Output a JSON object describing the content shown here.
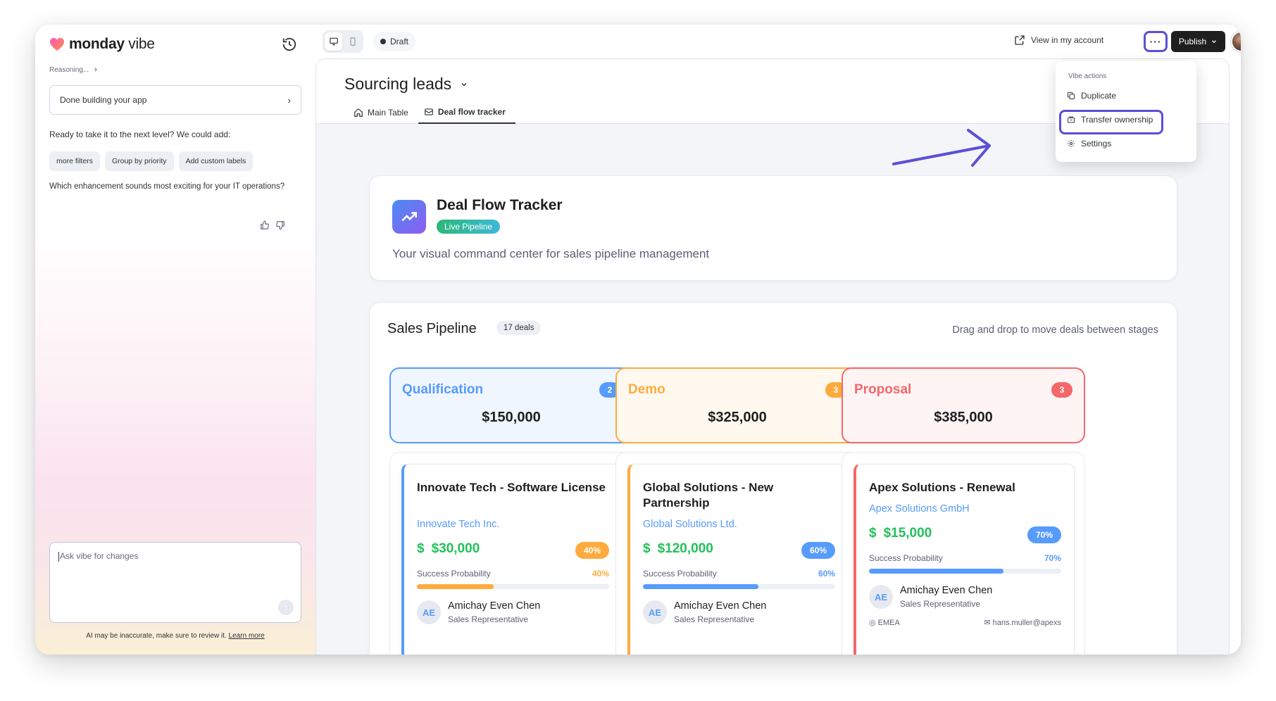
{
  "app": {
    "brand": "monday",
    "brand_suffix": "vibe",
    "reasoning_label": "Reasoning...",
    "status_box": "Done building your app",
    "ready_text": "Ready to take it to the next level? We could add:",
    "suggestions": [
      "more filters",
      "Group by priority",
      "Add custom labels"
    ],
    "question": "Which enhancement sounds most exciting for your IT operations?",
    "input_placeholder": "Ask vibe for changes",
    "disclaimer": "AI may be inaccurate, make sure to review it.",
    "learn_more": "Learn more"
  },
  "topbar": {
    "draft_label": "Draft",
    "view_account": "View in my account",
    "more_label": "···",
    "publish_label": "Publish"
  },
  "menu": {
    "header": "Vibe actions",
    "items": [
      "Duplicate",
      "Transfer ownership",
      "Settings"
    ]
  },
  "board": {
    "title": "Sourcing leads",
    "tabs": [
      "Main Table",
      "Deal flow tracker"
    ]
  },
  "hero": {
    "title": "Deal Flow Tracker",
    "badge": "Live Pipeline",
    "subtitle": "Your visual command center for sales pipeline management"
  },
  "pipeline": {
    "title": "Sales Pipeline",
    "count": "17 deals",
    "hint": "Drag and drop to move deals between stages",
    "stages": [
      {
        "name": "Qualification",
        "count": "2",
        "total": "$150,000",
        "color": "#579bfc"
      },
      {
        "name": "Demo",
        "count": "3",
        "total": "$325,000",
        "color": "#fdab3d"
      },
      {
        "name": "Proposal",
        "count": "3",
        "total": "$385,000",
        "color": "#f4676b"
      }
    ],
    "deals": [
      {
        "title": "Innovate Tech - Software License",
        "company": "Innovate Tech Inc.",
        "amount": "$30,000",
        "pct": "40%",
        "probability": 0.4,
        "prob_label": "Success Probability",
        "rep_initials": "AE",
        "rep_name": "Amichay Even Chen",
        "rep_role": "Sales Representative",
        "color": "#fdab3d"
      },
      {
        "title": "Global Solutions - New Partnership",
        "company": "Global Solutions Ltd.",
        "amount": "$120,000",
        "pct": "60%",
        "probability": 0.6,
        "prob_label": "Success Probability",
        "rep_initials": "AE",
        "rep_name": "Amichay Even Chen",
        "rep_role": "Sales Representative",
        "color": "#579bfc"
      },
      {
        "title": "Apex Solutions - Renewal",
        "company": "Apex Solutions GmbH",
        "amount": "$15,000",
        "pct": "70%",
        "probability": 0.7,
        "prob_label": "Success Probability",
        "rep_initials": "AE",
        "rep_name": "Amichay Even Chen",
        "rep_role": "Sales Representative",
        "region": "EMEA",
        "email": "hans.muller@apexs",
        "color": "#579bfc"
      }
    ]
  }
}
